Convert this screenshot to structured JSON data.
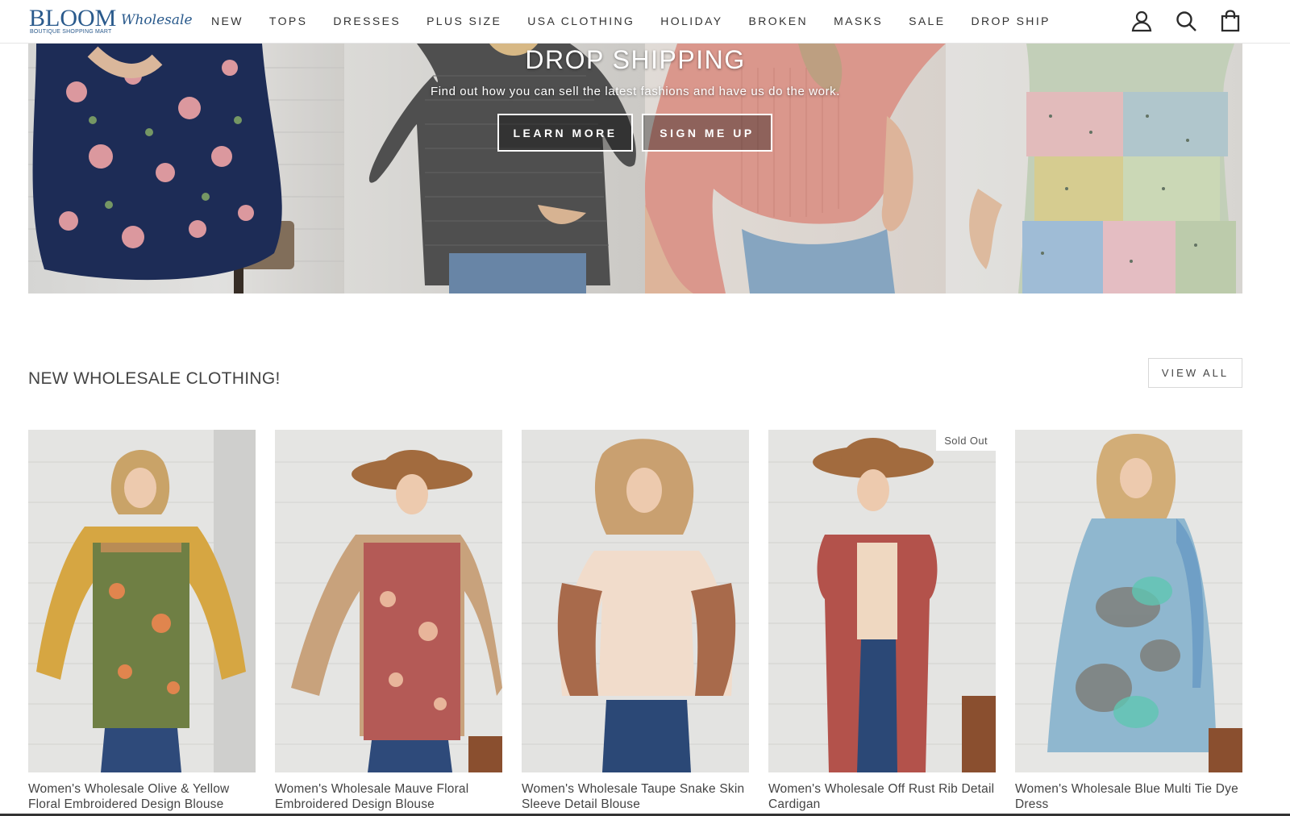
{
  "header": {
    "logo_main": "BLOOM",
    "logo_script": "Wholesale",
    "logo_tagline": "BOUTIQUE SHOPPING MART",
    "nav": [
      "NEW",
      "TOPS",
      "DRESSES",
      "PLUS SIZE",
      "USA CLOTHING",
      "HOLIDAY",
      "BROKEN",
      "MASKS",
      "SALE",
      "DROP SHIP"
    ],
    "icons": [
      "account-icon",
      "search-icon",
      "cart-icon"
    ]
  },
  "banner": {
    "title": "DROP SHIPPING",
    "subtitle": "Find out how you can sell the latest fashions and have us do the work.",
    "learn_more": "LEARN MORE",
    "sign_up": "SIGN ME UP"
  },
  "section": {
    "title": "NEW WHOLESALE CLOTHING!",
    "view_all": "VIEW ALL"
  },
  "products": [
    {
      "title": "Women's Wholesale Olive & Yellow Floral Embroidered Design Blouse",
      "badge": ""
    },
    {
      "title": "Women's Wholesale Mauve Floral Embroidered Design Blouse",
      "badge": ""
    },
    {
      "title": "Women's Wholesale Taupe Snake Skin Sleeve Detail Blouse",
      "badge": ""
    },
    {
      "title": "Women's Wholesale Off Rust Rib Detail Cardigan",
      "badge": "Sold Out"
    },
    {
      "title": "Women's Wholesale Blue Multi Tie Dye Dress",
      "badge": ""
    }
  ],
  "colors": {
    "brand": "#2a5a8c",
    "text": "#333333"
  }
}
